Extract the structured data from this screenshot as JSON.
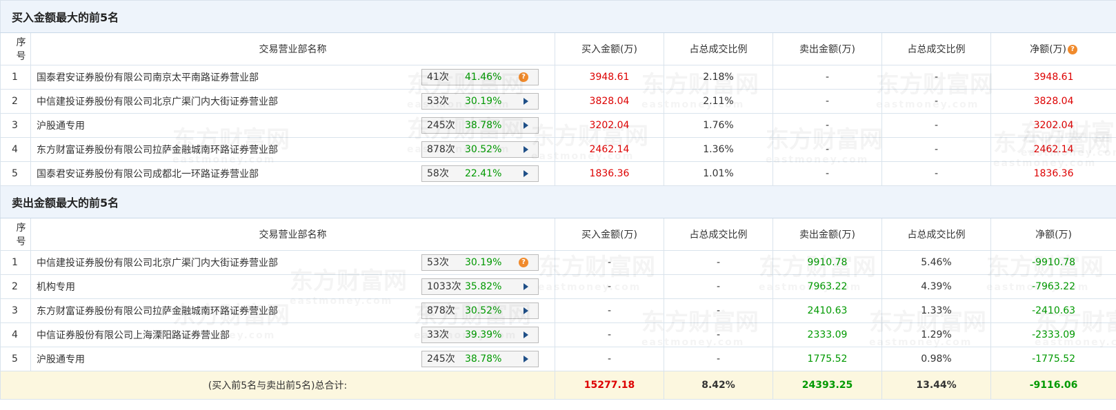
{
  "watermark": {
    "cn": "东方财富网",
    "en": "eastmoney.com"
  },
  "headers": {
    "idx": "序号",
    "name": "交易营业部名称",
    "buy": "买入金额(万)",
    "buy_ratio": "占总成交比例",
    "sell": "卖出金额(万)",
    "sell_ratio": "占总成交比例",
    "net": "净额(万)"
  },
  "buy_section": {
    "title": "买入金额最大的前5名",
    "rows": [
      {
        "idx": "1",
        "name": "国泰君安证券股份有限公司南京太平南路证券营业部",
        "count": "41次",
        "pct": "41.46%",
        "buy": "3948.61",
        "buy_ratio": "2.18%",
        "sell": "-",
        "sell_ratio": "-",
        "net": "3948.61"
      },
      {
        "idx": "2",
        "name": "中信建投证券股份有限公司北京广渠门内大街证券营业部",
        "count": "53次",
        "pct": "30.19%",
        "buy": "3828.04",
        "buy_ratio": "2.11%",
        "sell": "-",
        "sell_ratio": "-",
        "net": "3828.04"
      },
      {
        "idx": "3",
        "name": "沪股通专用",
        "count": "245次",
        "pct": "38.78%",
        "buy": "3202.04",
        "buy_ratio": "1.76%",
        "sell": "-",
        "sell_ratio": "-",
        "net": "3202.04"
      },
      {
        "idx": "4",
        "name": "东方财富证券股份有限公司拉萨金融城南环路证券营业部",
        "count": "878次",
        "pct": "30.52%",
        "buy": "2462.14",
        "buy_ratio": "1.36%",
        "sell": "-",
        "sell_ratio": "-",
        "net": "2462.14"
      },
      {
        "idx": "5",
        "name": "国泰君安证券股份有限公司成都北一环路证券营业部",
        "count": "58次",
        "pct": "22.41%",
        "buy": "1836.36",
        "buy_ratio": "1.01%",
        "sell": "-",
        "sell_ratio": "-",
        "net": "1836.36"
      }
    ]
  },
  "sell_section": {
    "title": "卖出金额最大的前5名",
    "rows": [
      {
        "idx": "1",
        "name": "中信建投证券股份有限公司北京广渠门内大街证券营业部",
        "count": "53次",
        "pct": "30.19%",
        "buy": "-",
        "buy_ratio": "-",
        "sell": "9910.78",
        "sell_ratio": "5.46%",
        "net": "-9910.78"
      },
      {
        "idx": "2",
        "name": "机构专用",
        "count": "1033次",
        "pct": "35.82%",
        "buy": "-",
        "buy_ratio": "-",
        "sell": "7963.22",
        "sell_ratio": "4.39%",
        "net": "-7963.22"
      },
      {
        "idx": "3",
        "name": "东方财富证券股份有限公司拉萨金融城南环路证券营业部",
        "count": "878次",
        "pct": "30.52%",
        "buy": "-",
        "buy_ratio": "-",
        "sell": "2410.63",
        "sell_ratio": "1.33%",
        "net": "-2410.63"
      },
      {
        "idx": "4",
        "name": "中信证券股份有限公司上海溧阳路证券营业部",
        "count": "33次",
        "pct": "39.39%",
        "buy": "-",
        "buy_ratio": "-",
        "sell": "2333.09",
        "sell_ratio": "1.29%",
        "net": "-2333.09"
      },
      {
        "idx": "5",
        "name": "沪股通专用",
        "count": "245次",
        "pct": "38.78%",
        "buy": "-",
        "buy_ratio": "-",
        "sell": "1775.52",
        "sell_ratio": "0.98%",
        "net": "-1775.52"
      }
    ]
  },
  "total": {
    "label": "(买入前5名与卖出前5名)总合计:",
    "buy": "15277.18",
    "buy_ratio": "8.42%",
    "sell": "24393.25",
    "sell_ratio": "13.44%",
    "net": "-9116.06"
  },
  "colors": {
    "positive": "#dd0000",
    "negative": "#009900",
    "title_bg": "#eef4fb",
    "total_bg": "#fcf7df"
  }
}
